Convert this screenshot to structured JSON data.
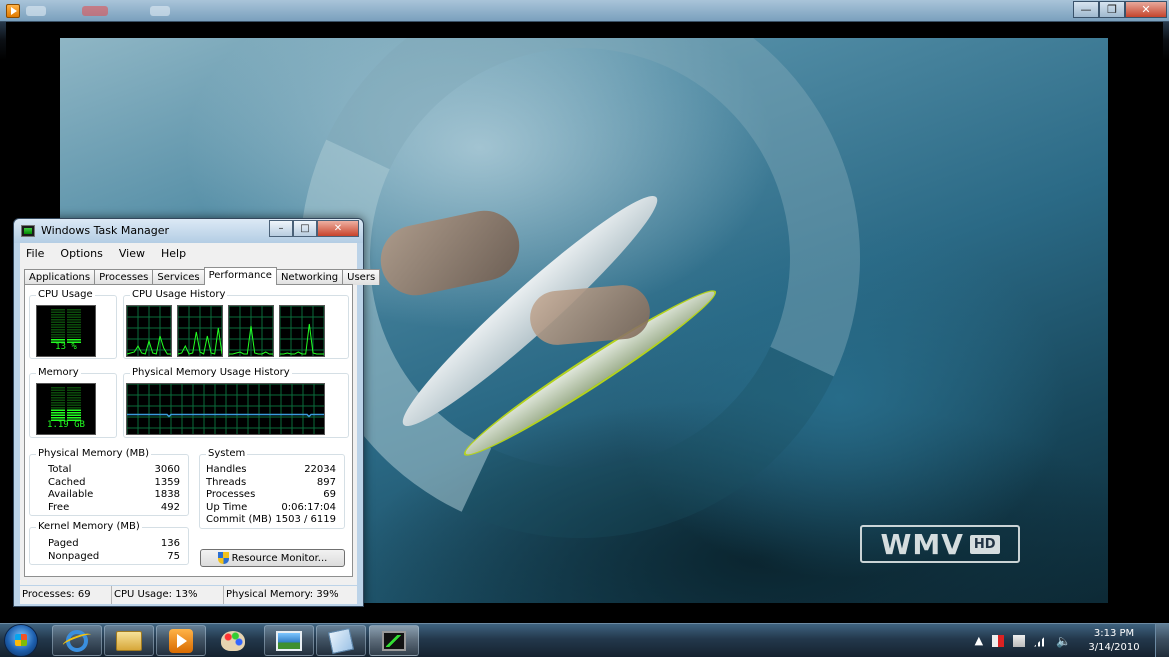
{
  "player": {
    "close_label": "✕",
    "restore_label": "❐",
    "minimize_label": "—",
    "watermark": {
      "main": "WMV",
      "hd": "HD"
    }
  },
  "task_manager": {
    "title": "Windows Task Manager",
    "min_label": "–",
    "max_label": "□",
    "close_label": "✕",
    "menu": [
      "File",
      "Options",
      "View",
      "Help"
    ],
    "tabs": [
      "Applications",
      "Processes",
      "Services",
      "Performance",
      "Networking",
      "Users"
    ],
    "active_tab": "Performance",
    "cpu_usage": {
      "label": "CPU Usage",
      "value": "13 %",
      "level": 0.13
    },
    "cpu_history": {
      "label": "CPU Usage History"
    },
    "memory": {
      "label": "Memory",
      "value": "1.19 GB",
      "level": 0.39
    },
    "memory_history": {
      "label": "Physical Memory Usage History"
    },
    "physical_memory": {
      "label": "Physical Memory (MB)",
      "rows": [
        {
          "name": "Total",
          "value": "3060"
        },
        {
          "name": "Cached",
          "value": "1359"
        },
        {
          "name": "Available",
          "value": "1838"
        },
        {
          "name": "Free",
          "value": "492"
        }
      ]
    },
    "kernel_memory": {
      "label": "Kernel Memory (MB)",
      "rows": [
        {
          "name": "Paged",
          "value": "136"
        },
        {
          "name": "Nonpaged",
          "value": "75"
        }
      ]
    },
    "system": {
      "label": "System",
      "rows": [
        {
          "name": "Handles",
          "value": "22034"
        },
        {
          "name": "Threads",
          "value": "897"
        },
        {
          "name": "Processes",
          "value": "69"
        },
        {
          "name": "Up Time",
          "value": "0:06:17:04"
        },
        {
          "name": "Commit (MB)",
          "value": "1503 / 6119"
        }
      ]
    },
    "resource_monitor_button": "Resource Monitor...",
    "status_bar": {
      "processes": "Processes: 69",
      "cpu": "CPU Usage: 13%",
      "memory": "Physical Memory: 39%"
    }
  },
  "taskbar": {
    "pinned": [
      "internet-explorer-icon",
      "folder-icon",
      "media-player-icon",
      "paint-icon",
      "photo-viewer-icon",
      "notes-icon",
      "task-manager-icon"
    ],
    "tray": {
      "expand_label": "▲",
      "volume_label": "🔈"
    },
    "clock": {
      "time": "3:13 PM",
      "date": "3/14/2010"
    }
  },
  "colors": {
    "meter_green": "#22ff22",
    "graph_grid": "#0a6b3a",
    "memory_line": "#3a9bdc"
  }
}
